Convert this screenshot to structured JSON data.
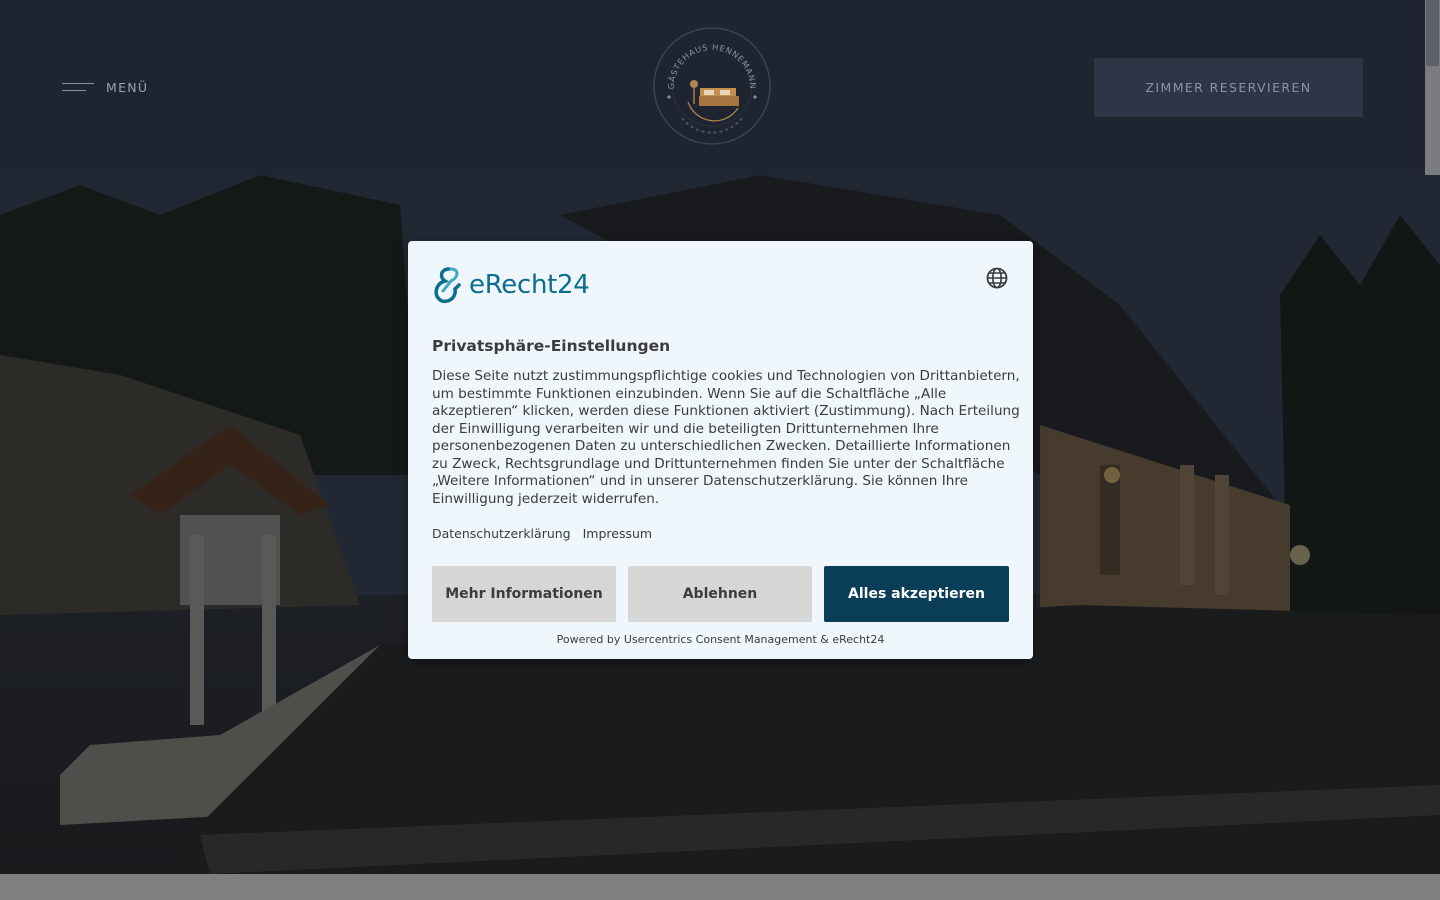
{
  "header": {
    "menu_label": "MENÜ",
    "logo_text": "GÄSTEHAUS HENNEMANN",
    "reserve_label": "ZIMMER RESERVIEREN"
  },
  "consent": {
    "brand": "eRecht24",
    "title": "Privatsphäre-Einstellungen",
    "body": "Diese Seite nutzt zustimmungspflichtige cookies und Technologien von Drittanbietern, um bestimmte Funktionen einzubinden. Wenn Sie auf die Schaltfläche „Alle akzeptieren“ klicken, werden diese Funktionen aktiviert (Zustimmung). Nach Erteilung der Einwilligung verarbeiten wir und die beteiligten Drittunternehmen Ihre personenbezogenen Daten zu unterschiedlichen Zwecken. Detaillierte Informationen zu Zweck, Rechtsgrundlage und Drittunternehmen finden Sie unter der Schaltfläche „Weitere Informationen“ und in unserer Datenschutzerklärung. Sie können Ihre Einwilligung jederzeit widerrufen.",
    "links": {
      "privacy": "Datenschutzerklärung",
      "imprint": "Impressum"
    },
    "buttons": {
      "more": "Mehr Informationen",
      "deny": "Ablehnen",
      "accept": "Alles akzeptieren"
    },
    "powered_by": "Powered by Usercentrics Consent Management & eRecht24"
  },
  "colors": {
    "header_bg": "#1f2530",
    "reserve_bg": "#2f3547",
    "brand_teal": "#0a6f8d",
    "accept_bg": "#0a3d58",
    "dialog_bg": "#eff6fc"
  },
  "icons": {
    "menu": "hamburger-icon",
    "language": "globe-icon",
    "logo": "guesthouse-bed-logo"
  }
}
